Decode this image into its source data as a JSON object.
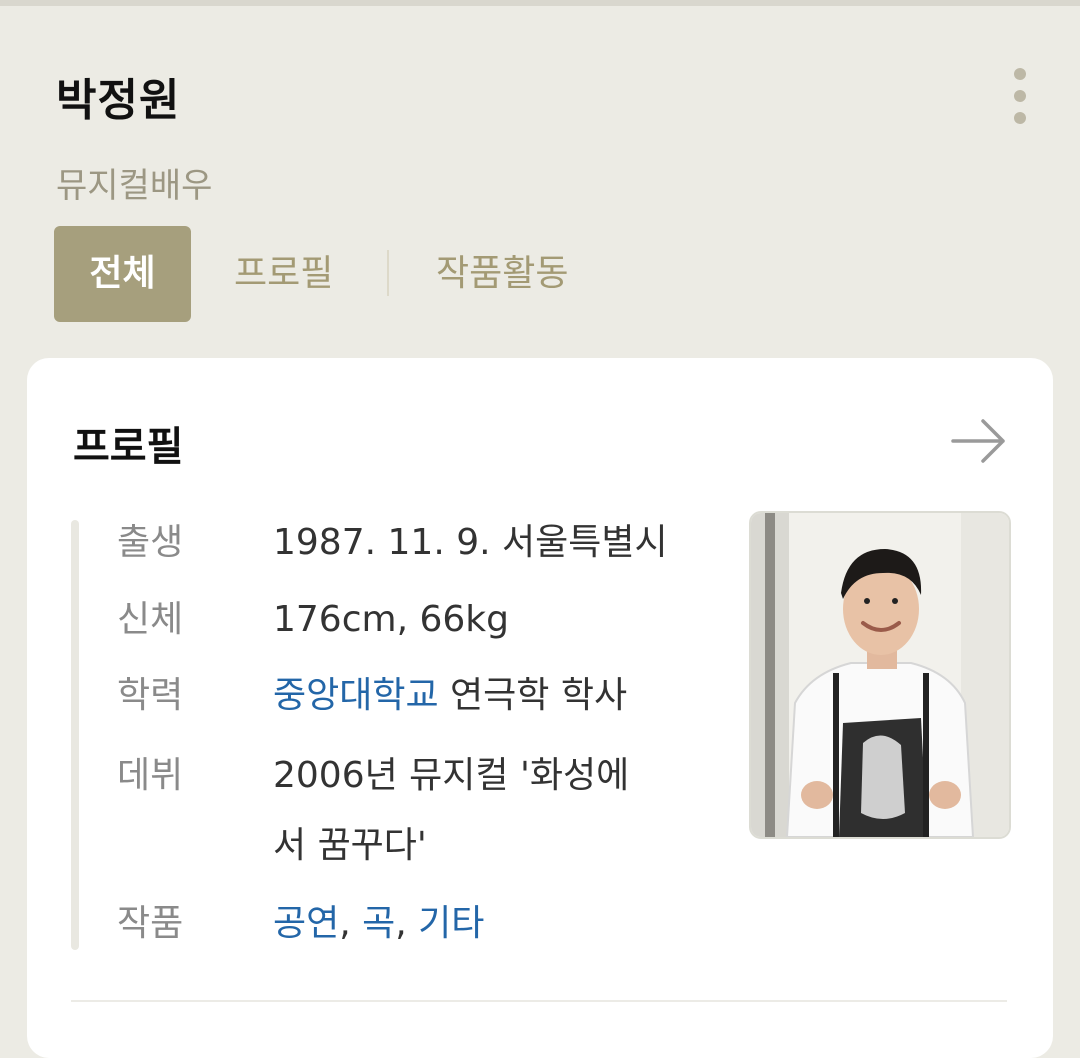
{
  "header": {
    "title": "박정원",
    "subtitle": "뮤지컬배우",
    "more_icon": "more-vertical-icon"
  },
  "tabs": [
    {
      "label": "전체",
      "active": true
    },
    {
      "label": "프로필",
      "active": false
    },
    {
      "label": "작품활동",
      "active": false
    }
  ],
  "profile": {
    "title": "프로필",
    "arrow_icon": "arrow-right-icon",
    "rows": [
      {
        "label": "출생",
        "value": "1987. 11. 9. 서울특별시"
      },
      {
        "label": "신체",
        "value": "176cm, 66kg"
      },
      {
        "label": "학력",
        "link": "중앙대학교",
        "value": " 연극학 학사"
      },
      {
        "label": "데뷔",
        "value_line1": "2006년 뮤지컬 '화성에",
        "value_line2": "서 꿈꾸다'"
      },
      {
        "label": "작품",
        "works": [
          "공연",
          "곡",
          "기타"
        ],
        "sep": ", "
      }
    ],
    "photo_icon": "profile-photo"
  },
  "colors": {
    "background": "#ecebe4",
    "accent": "#a69f7d",
    "link": "#2366a8"
  }
}
